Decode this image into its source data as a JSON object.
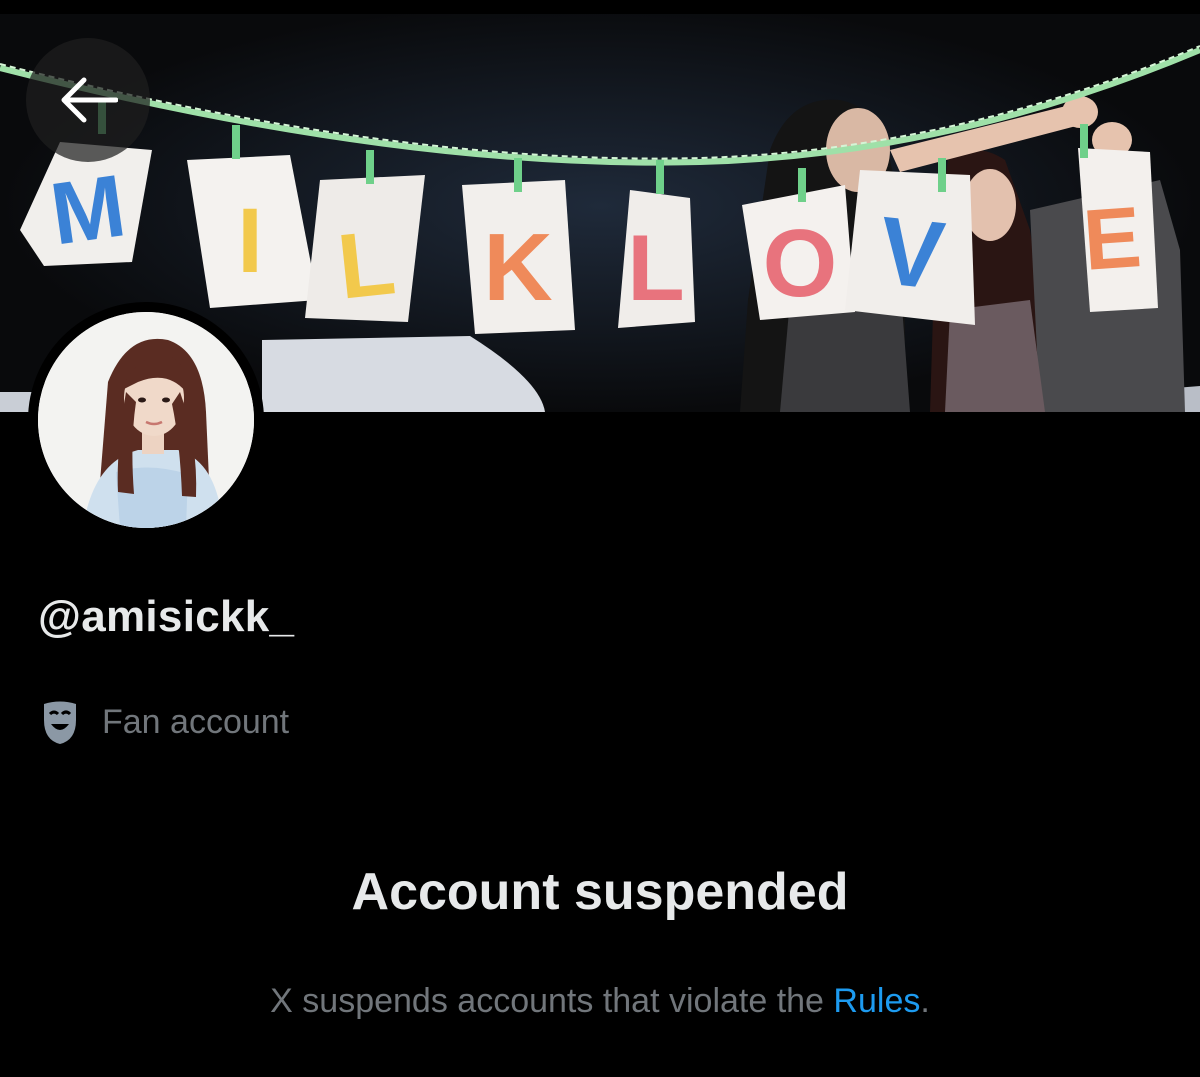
{
  "profile": {
    "handle": "@amisickk_",
    "category_icon": "theater-masks-icon",
    "category": "Fan account"
  },
  "banner": {
    "letters": [
      {
        "char": "M",
        "color": "#3b82d6"
      },
      {
        "char": "I",
        "color": "#f2c94c"
      },
      {
        "char": "L",
        "color": "#f2c94c"
      },
      {
        "char": "K",
        "color": "#ef8a5a"
      },
      {
        "char": "L",
        "color": "#e8737d"
      },
      {
        "char": "O",
        "color": "#e8737d"
      },
      {
        "char": "V",
        "color": "#3b82d6"
      },
      {
        "char": "E",
        "color": "#ef8a5a"
      }
    ]
  },
  "nav": {
    "back_icon": "arrow-left-icon"
  },
  "suspension": {
    "title": "Account suspended",
    "body_prefix": "X suspends accounts that violate the ",
    "link_text": "Rules",
    "body_suffix": "."
  },
  "colors": {
    "background": "#000000",
    "muted": "#71767b",
    "link": "#1d9bf0",
    "text": "#e7e9ea"
  }
}
